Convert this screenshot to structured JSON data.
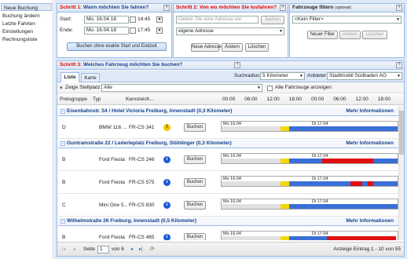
{
  "sidebar": {
    "items": [
      {
        "label": "Neue Buchung",
        "active": true
      },
      {
        "label": "Buchung ändern"
      },
      {
        "label": "Letzte Fahrten"
      },
      {
        "label": "Einstellungen"
      },
      {
        "label": "Rechnungsliste"
      }
    ]
  },
  "step1": {
    "title_num": "Schritt 1:",
    "title": "Wann möchten Sie fahren?",
    "start_label": "Start:",
    "start_date": "Mo. 16.04.18",
    "start_time": "14:45",
    "end_label": "Ende:",
    "end_date": "Mo. 16.04.18",
    "end_time": "17:45",
    "no_time_button": "Buchen ohne exakte Start und Endzeit"
  },
  "step2": {
    "title_num": "Schritt 2:",
    "title": "Von wo möchten Sie losfahren?",
    "address_placeholder": "Geben Sie eine Adresse ein",
    "search_button": "Suchen",
    "address_select": "eigene Adresse",
    "new_button": "Neue Adresse",
    "change_button": "Ändern",
    "delete_button": "Löschen"
  },
  "filter": {
    "title": "Fahrzeuge filtern",
    "title_small": "(optional)",
    "select": "<Kein Filter>",
    "new_button": "Neuer Filter",
    "change_button": "Ändern",
    "delete_button": "Löschen"
  },
  "step3": {
    "title_num": "Schritt 3:",
    "title": "Welches Fahrzeug möchten Sie buchen?",
    "tabs": [
      "Liste",
      "Karte"
    ],
    "radius_label": "Suchradius:",
    "radius_value": "5 Kilometer",
    "provider_label": "Anbieter:",
    "provider_value": "Stadtmobil Südbaden AG",
    "stellplatz_label": "Zeige Stellplatz:",
    "stellplatz_value": "Alle",
    "all_vehicles_label": "Alle Fahrzeuge anzeigen",
    "columns": [
      "Preisgruppe",
      "Typ",
      "Kennzeich..."
    ],
    "times": [
      "00:00",
      "06:00",
      "12:00",
      "18:00",
      "00:00",
      "06:00",
      "12:00",
      "18:00"
    ]
  },
  "groups": [
    {
      "title": "Eisenbahnstr. 54 / Hotel Victoria Freiburg, Innenstadt (0,3 Kilometer)",
      "more": "Mehr Informationen",
      "rows": [
        {
          "group": "D",
          "type": "BMW 116 ...",
          "plate": "FR-CS 341",
          "icon": "warn",
          "book": "Buchen",
          "day1": "Mo 16.04",
          "day2": "Di 17.04",
          "bars": [
            {
              "start": 0,
              "end": 0.335,
              "color": "#e0e0e0"
            },
            {
              "start": 0.335,
              "end": 0.385,
              "color": "#f5d800"
            },
            {
              "start": 0.385,
              "end": 0.515,
              "color": "#3a6fd8"
            },
            {
              "start": 0.515,
              "end": 1,
              "color": "#3a6fd8"
            }
          ]
        }
      ]
    },
    {
      "title": "Guntramstraße 22 / Lederleplatz Freiburg, Stühlinger (0,3 Kilometer)",
      "more": "Mehr Informationen",
      "rows": [
        {
          "group": "B",
          "type": "Ford Fiesta",
          "plate": "FR-CS 246",
          "icon": "info",
          "book": "Buchen",
          "day1": "Mo 16.04",
          "day2": "Di 17.04",
          "bars": [
            {
              "start": 0,
              "end": 0.335,
              "color": "#e0e0e0"
            },
            {
              "start": 0.335,
              "end": 0.385,
              "color": "#f5d800"
            },
            {
              "start": 0.385,
              "end": 0.515,
              "color": "#3a6fd8"
            },
            {
              "start": 0.515,
              "end": 0.57,
              "color": "#3a6fd8"
            },
            {
              "start": 0.57,
              "end": 0.86,
              "color": "#e01010"
            },
            {
              "start": 0.86,
              "end": 1,
              "color": "#3a6fd8"
            }
          ]
        },
        {
          "group": "B",
          "type": "Ford Fiesta",
          "plate": "FR-CS 575",
          "icon": "info",
          "book": "Buchen",
          "day1": "Mo 16.04",
          "day2": "Di 17.04",
          "bars": [
            {
              "start": 0,
              "end": 0.335,
              "color": "#e0e0e0"
            },
            {
              "start": 0.335,
              "end": 0.385,
              "color": "#f5d800"
            },
            {
              "start": 0.385,
              "end": 0.515,
              "color": "#3a6fd8"
            },
            {
              "start": 0.515,
              "end": 0.73,
              "color": "#3a6fd8"
            },
            {
              "start": 0.73,
              "end": 0.8,
              "color": "#e01010"
            },
            {
              "start": 0.8,
              "end": 0.83,
              "color": "#3a6fd8"
            },
            {
              "start": 0.83,
              "end": 0.86,
              "color": "#e01010"
            },
            {
              "start": 0.86,
              "end": 1,
              "color": "#3a6fd8"
            }
          ]
        },
        {
          "group": "C",
          "type": "Mini One 5...",
          "plate": "FR-CS 830",
          "icon": "info",
          "book": "Buchen",
          "day1": "Mo 16.04",
          "day2": "Di 17.04",
          "bars": [
            {
              "start": 0,
              "end": 0.335,
              "color": "#e0e0e0"
            },
            {
              "start": 0.335,
              "end": 0.385,
              "color": "#f5d800"
            },
            {
              "start": 0.385,
              "end": 0.515,
              "color": "#3a6fd8"
            },
            {
              "start": 0.515,
              "end": 1,
              "color": "#3a6fd8"
            }
          ]
        }
      ]
    },
    {
      "title": "Wilhelmstraße 26 Freiburg, Innenstadt (0,5 Kilometer)",
      "more": "Mehr Informationen",
      "rows": [
        {
          "group": "B",
          "type": "Ford Fiesta",
          "plate": "FR-CS 465",
          "icon": "info",
          "book": "Buchen",
          "day1": "Mo 16.04",
          "day2": "Di 17.04",
          "bars": [
            {
              "start": 0,
              "end": 0.335,
              "color": "#e0e0e0"
            },
            {
              "start": 0.335,
              "end": 0.385,
              "color": "#f5d800"
            },
            {
              "start": 0.385,
              "end": 0.515,
              "color": "#3a6fd8"
            },
            {
              "start": 0.515,
              "end": 0.6,
              "color": "#3a6fd8"
            },
            {
              "start": 0.6,
              "end": 0.99,
              "color": "#e01010"
            }
          ]
        }
      ]
    }
  ],
  "pager": {
    "page_label": "Seite",
    "page": "1",
    "of_label": "von 6",
    "display": "Anzeige Eintrag 1 - 10 von 55"
  }
}
